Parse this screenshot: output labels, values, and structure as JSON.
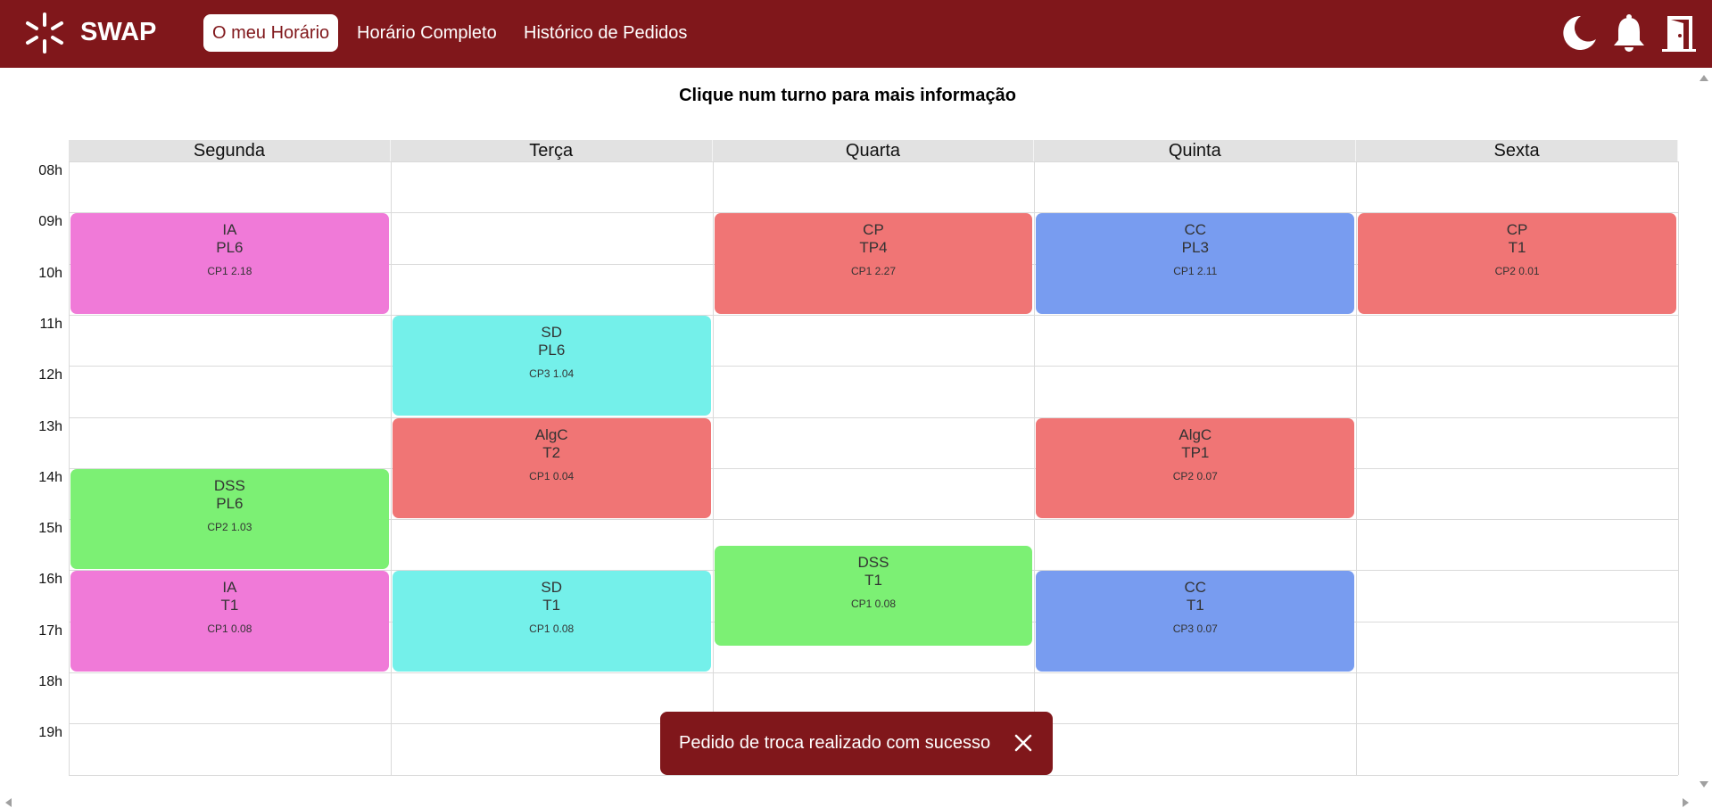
{
  "app": {
    "brand": "SWAP"
  },
  "nav": [
    {
      "label": "O meu Horário",
      "active": true
    },
    {
      "label": "Horário Completo",
      "active": false
    },
    {
      "label": "Histórico de Pedidos",
      "active": false
    }
  ],
  "header_icons": [
    "moon-icon",
    "bell-icon",
    "door-exit-icon"
  ],
  "subtitle": "Clique num turno para mais informação",
  "days": [
    "Segunda",
    "Terça",
    "Quarta",
    "Quinta",
    "Sexta"
  ],
  "hours": [
    "08h",
    "09h",
    "10h",
    "11h",
    "12h",
    "13h",
    "14h",
    "15h",
    "16h",
    "17h",
    "18h",
    "19h"
  ],
  "colors": {
    "brand": "#80171b",
    "IA": "#f07ad8",
    "CP": "#f07575",
    "AlgC": "#f07575",
    "CC": "#789cf0",
    "SD": "#74f0ea",
    "DSS": "#7cf074"
  },
  "events": [
    {
      "day": 0,
      "start": 9,
      "end": 11,
      "name": "IA",
      "type": "PL6",
      "room": "CP1 2.18"
    },
    {
      "day": 0,
      "start": 14,
      "end": 16,
      "name": "DSS",
      "type": "PL6",
      "room": "CP2 1.03"
    },
    {
      "day": 0,
      "start": 16,
      "end": 18,
      "name": "IA",
      "type": "T1",
      "room": "CP1 0.08"
    },
    {
      "day": 1,
      "start": 11,
      "end": 13,
      "name": "SD",
      "type": "PL6",
      "room": "CP3 1.04"
    },
    {
      "day": 1,
      "start": 13,
      "end": 15,
      "name": "AlgC",
      "type": "T2",
      "room": "CP1 0.04"
    },
    {
      "day": 1,
      "start": 16,
      "end": 18,
      "name": "SD",
      "type": "T1",
      "room": "CP1 0.08"
    },
    {
      "day": 2,
      "start": 9,
      "end": 11,
      "name": "CP",
      "type": "TP4",
      "room": "CP1 2.27"
    },
    {
      "day": 2,
      "start": 15.5,
      "end": 17.5,
      "name": "DSS",
      "type": "T1",
      "room": "CP1 0.08"
    },
    {
      "day": 3,
      "start": 9,
      "end": 11,
      "name": "CC",
      "type": "PL3",
      "room": "CP1 2.11"
    },
    {
      "day": 3,
      "start": 13,
      "end": 15,
      "name": "AlgC",
      "type": "TP1",
      "room": "CP2 0.07"
    },
    {
      "day": 3,
      "start": 16,
      "end": 18,
      "name": "CC",
      "type": "T1",
      "room": "CP3 0.07"
    },
    {
      "day": 4,
      "start": 9,
      "end": 11,
      "name": "CP",
      "type": "T1",
      "room": "CP2 0.01"
    }
  ],
  "toast": {
    "message": "Pedido de troca realizado com sucesso",
    "icon": "close-icon"
  }
}
